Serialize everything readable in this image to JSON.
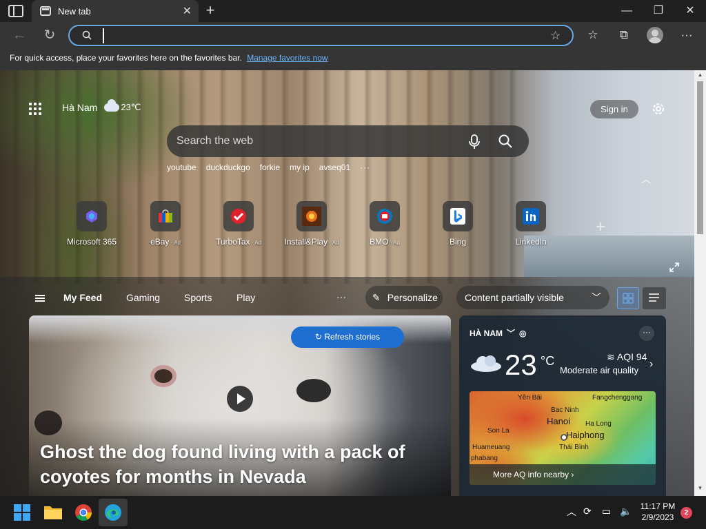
{
  "browser": {
    "tab_title": "New tab",
    "omnibox_value": "",
    "favorites_hint": "For quick access, place your favorites here on the favorites bar.",
    "manage_favorites": "Manage favorites now"
  },
  "ntp": {
    "location": "Hà Nam",
    "temp": "23℃",
    "sign_in": "Sign in",
    "search_placeholder": "Search the web",
    "suggestions": [
      "youtube",
      "duckduckgo",
      "forkie",
      "my ip",
      "avseq01"
    ],
    "more": "···",
    "tiles": [
      {
        "label": "Microsoft 365",
        "ad": ""
      },
      {
        "label": "eBay",
        "ad": "Ad"
      },
      {
        "label": "TurboTax",
        "ad": "Ad"
      },
      {
        "label": "Install&Play",
        "ad": "Ad"
      },
      {
        "label": "BMO",
        "ad": "Ad"
      },
      {
        "label": "Bing",
        "ad": ""
      },
      {
        "label": "LinkedIn",
        "ad": ""
      }
    ],
    "ad_sep": " · "
  },
  "feed": {
    "tabs": [
      "My Feed",
      "Gaming",
      "Sports",
      "Play"
    ],
    "more": "···",
    "personalize": "Personalize",
    "content_visibility": "Content partially visible"
  },
  "story": {
    "refresh": "Refresh stories",
    "headline": "Ghost the dog found living with a pack of coyotes for months in Nevada"
  },
  "weather": {
    "location": "HÀ NAM",
    "temp": "23",
    "unit": "°C",
    "aqi": "AQI 94",
    "aqi_text": "Moderate air quality",
    "map_labels": [
      "Yên Bái",
      "Bac Ninh",
      "Son La",
      "Hanoi",
      "Ha Long",
      "Fangchenggang",
      "Haiphong",
      "Huameuang",
      "Thái Bình",
      "phabang"
    ],
    "more_link": "More AQ info nearby"
  },
  "taskbar": {
    "time": "11:17 PM",
    "date": "2/9/2023",
    "notifications": "2"
  },
  "colors": {
    "accent": "#1f6fd0",
    "omnibox_border": "#69a8e6",
    "link": "#6cb6ff"
  }
}
